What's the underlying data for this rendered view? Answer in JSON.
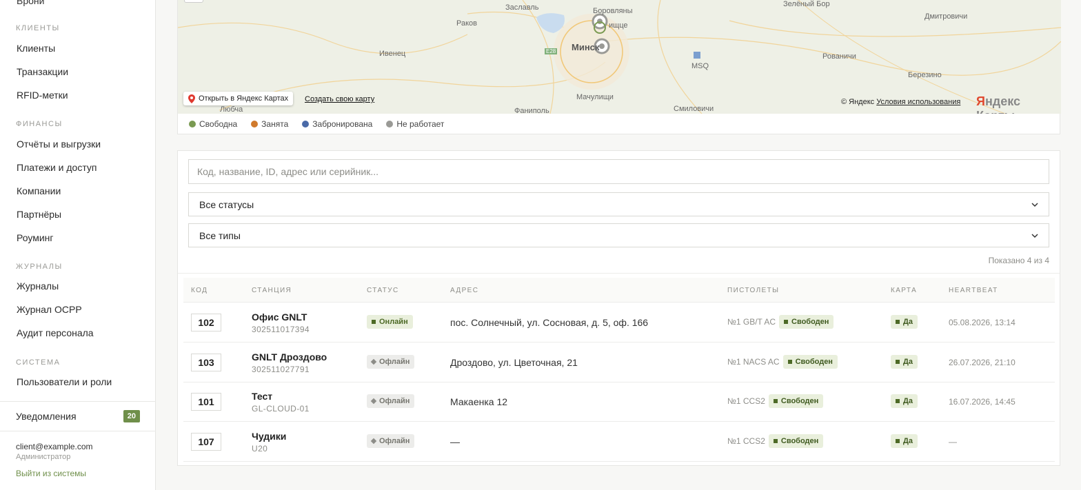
{
  "sidebar": {
    "prev_item": "Врони",
    "sections": [
      {
        "title": "Клиенты",
        "items": [
          "Клиенты",
          "Транзакции",
          "RFID-метки"
        ]
      },
      {
        "title": "Финансы",
        "items": [
          "Отчёты и выгрузки",
          "Платежи и доступ",
          "Компании",
          "Партнёры",
          "Роуминг"
        ]
      },
      {
        "title": "Журналы",
        "items": [
          "Журналы",
          "Журнал OCPP",
          "Аудит персонала"
        ]
      },
      {
        "title": "Система",
        "items": [
          "Пользователи и роли"
        ]
      }
    ],
    "notifications_label": "Уведомления",
    "notifications_count": "20",
    "user_email": "client@example.com",
    "user_role": "Администратор",
    "logout": "Выйти из системы",
    "accent_color": "#6f8f4a"
  },
  "map": {
    "labels": {
      "zaslavl": "Заславль",
      "borovlyany": "Боровляны",
      "zelenyi_bor": "Зелёный Бор",
      "dmitrovichi": "Дмитровичи",
      "rakov": "Раков",
      "ivenets": "Ивенец",
      "minsk": "Минск",
      "ratomka": "ищце",
      "rovanichi": "Рованичи",
      "msq": "MSQ",
      "berezino": "Березино",
      "lyuba": "Любча",
      "machulishchi": "Мачулищи",
      "fanipol": "Фаниполь",
      "smilovichi": "Смиловичи",
      "e28": "E28"
    },
    "open_button": "Открыть в Яндекс Картах",
    "create_map_link": "Создать свою карту",
    "copyright": "© Яндекс",
    "terms_link": "Условия использования",
    "logo_first": "Я",
    "logo_rest": "ндекс Карты"
  },
  "legend": [
    {
      "label": "Свободна",
      "color": "#7a9a52"
    },
    {
      "label": "Занята",
      "color": "#d07a2c"
    },
    {
      "label": "Забронирована",
      "color": "#4a6aa8"
    },
    {
      "label": "Не работает",
      "color": "#9a9a96"
    }
  ],
  "filters": {
    "search_placeholder": "Код, название, ID, адрес или серийник...",
    "status_select": "Все статусы",
    "type_select": "Все типы",
    "shown_text": "Показано 4 из 4"
  },
  "table": {
    "columns": [
      "Код",
      "Станция",
      "Статус",
      "Адрес",
      "Пистолеты",
      "Карта",
      "Heartbeat"
    ],
    "rows": [
      {
        "code": "102",
        "name": "Офис GNLT",
        "serial": "302511017394",
        "status": "Онлайн",
        "online": true,
        "address": "пос. Солнечный, ул. Сосновая, д. 5, оф. 166",
        "gun": "№1 GB/T AC",
        "gun_status": "Свободен",
        "card": "Да",
        "heartbeat": "05.08.2026, 13:14"
      },
      {
        "code": "103",
        "name": "GNLT Дроздово",
        "serial": "302511027791",
        "status": "Офлайн",
        "online": false,
        "address": "Дроздово, ул. Цветочная, 21",
        "gun": "№1 NACS AC",
        "gun_status": "Свободен",
        "card": "Да",
        "heartbeat": "26.07.2026, 21:10"
      },
      {
        "code": "101",
        "name": "Тест",
        "serial": "GL-CLOUD-01",
        "status": "Офлайн",
        "online": false,
        "address": "Макаенка 12",
        "gun": "№1 CCS2",
        "gun_status": "Свободен",
        "card": "Да",
        "heartbeat": "16.07.2026, 14:45"
      },
      {
        "code": "107",
        "name": "Чудики",
        "serial": "U20",
        "status": "Офлайн",
        "online": false,
        "address": "—",
        "gun": "№1 CCS2",
        "gun_status": "Свободен",
        "card": "Да",
        "heartbeat": "—"
      }
    ]
  }
}
